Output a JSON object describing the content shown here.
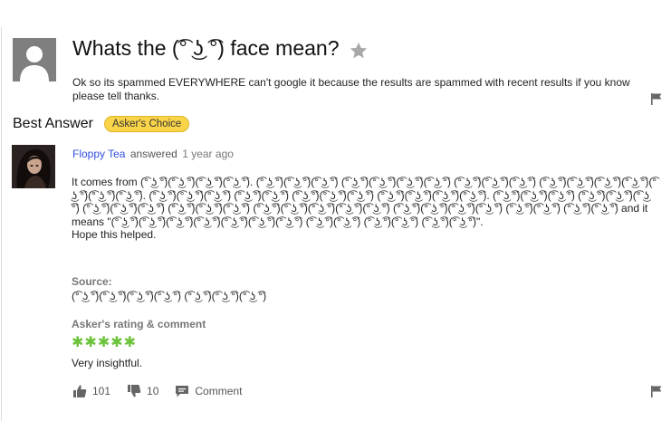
{
  "question": {
    "title": "Whats the (͡° ͜ʖ ͡°) face mean?",
    "body": "Ok so its spammed EVERYWHERE can't google it because the results are spammed with recent results if you know please tell thanks."
  },
  "best_answer": {
    "heading": "Best Answer",
    "badge": "Asker's Choice",
    "username": "Floppy Tea",
    "answered_word": "answered",
    "time_ago": "1 year ago",
    "body_main": "It comes from (͡° ͜ʖ ͡°)(͡° ͜ʖ ͡°)(͡° ͜ʖ ͡°)(͡° ͜ʖ ͡°). (͡° ͜ʖ ͡°)(͡° ͜ʖ ͡°)(͡° ͜ʖ ͡°) (͡° ͜ʖ ͡°)(͡° ͜ʖ ͡°)(͡° ͜ʖ ͡°)(͡° ͜ʖ ͡°) (͡° ͜ʖ ͡°)(͡° ͜ʖ ͡°)(͡° ͜ʖ ͡°) (͡° ͜ʖ ͡°)(͡° ͜ʖ ͡°)(͡° ͜ʖ ͡°)(͡° ͜ʖ ͡°)(͡° ͜ʖ ͡°)(͡° ͜ʖ ͡°)(͡° ͜ʖ ͡°). (͡° ͜ʖ ͡°)(͡° ͜ʖ ͡°)(͡° ͜ʖ ͡°) (͡° ͜ʖ ͡°)(͡° ͜ʖ ͡°) (͡° ͜ʖ ͡°)(͡° ͜ʖ ͡°)(͡° ͜ʖ ͡°) (͡° ͜ʖ ͡°)(͡° ͜ʖ ͡°)(͡° ͜ʖ ͡°)(͡° ͜ʖ ͡°). (͡° ͜ʖ ͡°)(͡° ͜ʖ ͡°)(͡° ͜ʖ ͡°) (͡° ͜ʖ ͡°)(͡° ͜ʖ ͡°)(͡° ͜ʖ ͡°) (͡° ͜ʖ ͡°)(͡° ͜ʖ ͡°)(͡° ͜ʖ ͡°) (͡° ͜ʖ ͡°)(͡° ͜ʖ ͡°)(͡° ͜ʖ ͡°) (͡° ͜ʖ ͡°)(͡° ͜ʖ ͡°)(͡° ͜ʖ ͡°)(͡° ͜ʖ ͡°)(͡° ͜ʖ ͡°) (͡° ͜ʖ ͡°)(͡° ͜ʖ ͡°)(͡° ͜ʖ ͡°)(͡° ͜ʖ ͡°) (͡° ͜ʖ ͡°)(͡° ͜ʖ ͡°) (͡° ͜ʖ ͡°)(͡° ͜ʖ ͡°) and it means \"(͡° ͜ʖ ͡°)(͡° ͜ʖ ͡°)(͡° ͜ʖ ͡°)(͡° ͜ʖ ͡°)(͡° ͜ʖ ͡°)(͡° ͜ʖ ͡°)(͡° ͜ʖ ͡°) (͡° ͜ʖ ͡°)(͡° ͜ʖ ͡°) (͡° ͜ʖ ͡°)(͡° ͜ʖ ͡°) (͡° ͜ʖ ͡°)(͡° ͜ʖ ͡°)\".",
    "body_end": "Hope this helped.",
    "source_label": "Source:",
    "source_text": "(͡° ͜ʖ ͡°)(͡° ͜ʖ ͡°)(͡° ͜ʖ ͡°)(͡° ͜ʖ ͡°) (͡° ͜ʖ ͡°)(͡° ͜ʖ ͡°)(͡° ͜ʖ ͡°)",
    "rating_label": "Asker's rating & comment",
    "rating_stars": "✱✱✱✱✱",
    "rating_value": 5,
    "rating_comment": "Very insightful.",
    "thumbs_up_count": "101",
    "thumbs_down_count": "10",
    "comment_label": "Comment"
  },
  "colors": {
    "link": "#324fe1",
    "badge": "#f9d449",
    "stars": "#6cc33b",
    "icon": "#666666"
  }
}
